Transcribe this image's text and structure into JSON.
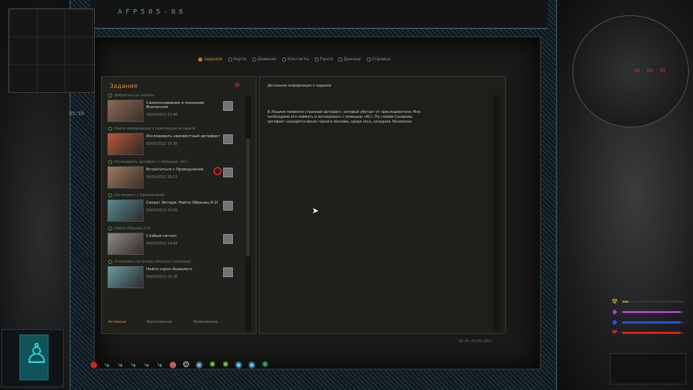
{
  "pda": {
    "serial": "AFP505-06"
  },
  "tabs": [
    {
      "label": "Задания",
      "active": true
    },
    {
      "label": "Карта",
      "active": false
    },
    {
      "label": "Дневник",
      "active": false
    },
    {
      "label": "Контакты",
      "active": false
    },
    {
      "label": "Ранги",
      "active": false
    },
    {
      "label": "Данные",
      "active": false
    },
    {
      "label": "Справка",
      "active": false
    }
  ],
  "tasks_panel": {
    "title": "Задания",
    "first_objective": "Добраться до антены",
    "tasks": [
      {
        "title": "Самопознавание и познание Вселенной",
        "date": "05/05/2012 21:48",
        "objective": "Найти информацию о самогонном аппарате"
      },
      {
        "title": "Исследовать неизвестный артефакт",
        "date": "05/05/2012 16:18",
        "objective": "Исследовать артефакт с помощью «АС»"
      },
      {
        "title": "Встретиться с Проводником",
        "date": "05/05/2012 15:11",
        "objective": "Поговорить с Проводником"
      },
      {
        "title": "Секрет Янтаря: Найти Образец 0-2I",
        "date": "04/05/2012 19:56",
        "objective": "Найти Образец 0-2I"
      },
      {
        "title": "Слабый сигнал",
        "date": "04/05/2012 19:44",
        "objective": "Установить источник сигнала с помощью"
      },
      {
        "title": "Найти схрон Бывалого",
        "date": "04/05/2012 15:18",
        "objective": ""
      }
    ],
    "filters": [
      {
        "label": "Активные",
        "active": true
      },
      {
        "label": "Выполненные",
        "active": false
      },
      {
        "label": "Проваленные",
        "active": false
      }
    ]
  },
  "details": {
    "header": "Детальная информация о задании",
    "body": "В Лощине появился странный артефакт, который убегает от преследователя. Мне необходимо его поймать и исследовать с помощью «АС». По словам Сахарова, артефакт находится возле горного массива, среди леса, западнее Лесопилки",
    "footer": "05:00 05/05/2012"
  },
  "hud": {
    "minimap_time": "05:59",
    "detector_values": [
      "30",
      "60",
      "90"
    ]
  },
  "stats": [
    {
      "icon": "radiation-icon",
      "glyph": "☢",
      "color": "#d8c030",
      "level": 0.1
    },
    {
      "icon": "psy-icon",
      "glyph": "◆",
      "color": "#b040c0",
      "level": 0.95
    },
    {
      "icon": "stamina-icon",
      "glyph": "◆",
      "color": "#3050e0",
      "level": 0.95
    },
    {
      "icon": "health-icon",
      "glyph": "❤",
      "color": "#e02020",
      "level": 0.95
    }
  ]
}
